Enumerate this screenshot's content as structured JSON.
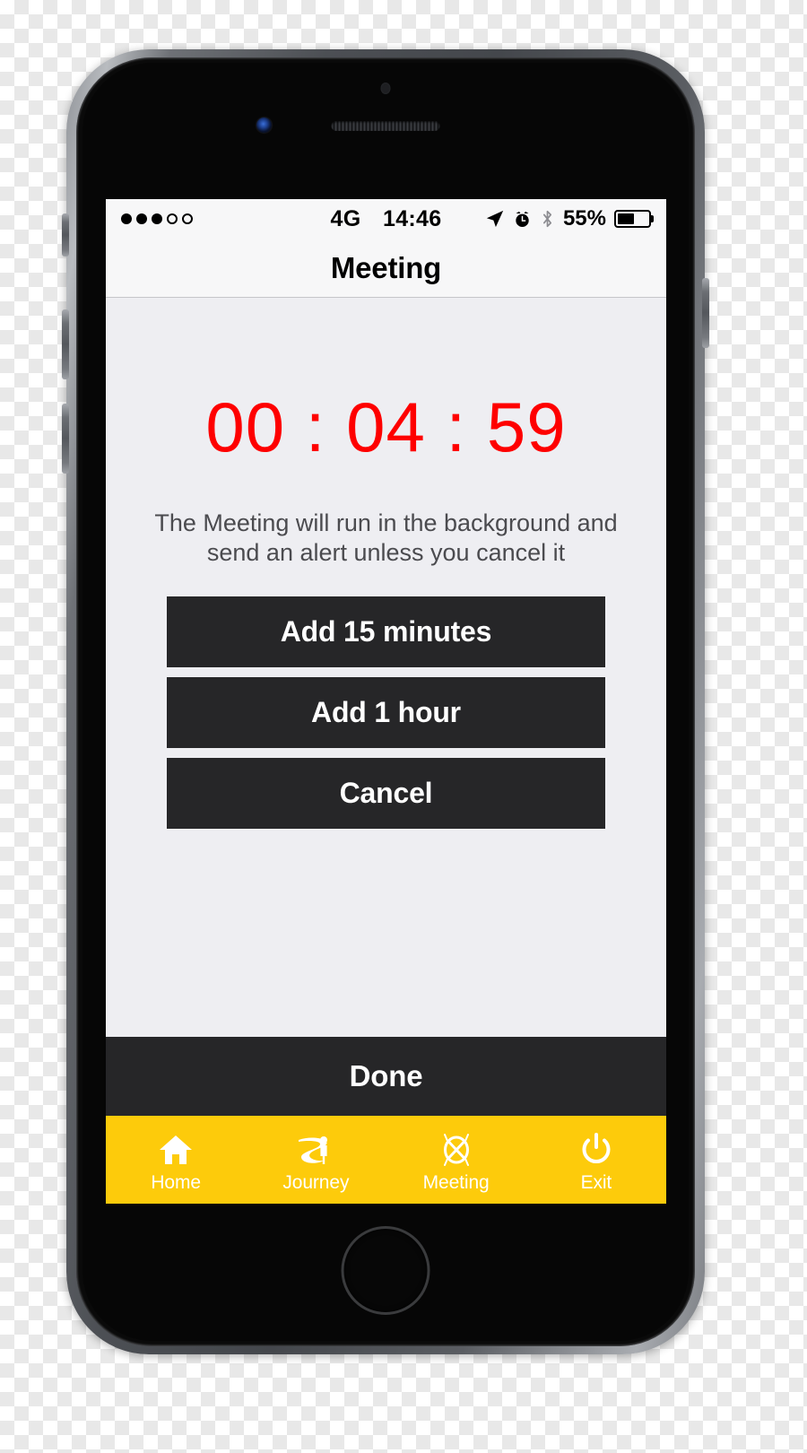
{
  "status_bar": {
    "signal_dots_filled": 3,
    "signal_dots_total": 5,
    "network": "4G",
    "time": "14:46",
    "battery_percent": "55%",
    "battery_level": 55,
    "icons": [
      "location-arrow-icon",
      "alarm-clock-icon",
      "bluetooth-icon"
    ]
  },
  "nav": {
    "title": "Meeting"
  },
  "main": {
    "timer": "00 : 04 : 59",
    "timer_color": "#fe0000",
    "description": "The Meeting will run in the background and send an alert unless you cancel it",
    "buttons": [
      {
        "label": "Add 15 minutes",
        "name": "add-15-minutes-button"
      },
      {
        "label": "Add 1 hour",
        "name": "add-1-hour-button"
      },
      {
        "label": "Cancel",
        "name": "cancel-button"
      }
    ],
    "done_label": "Done"
  },
  "tab_bar": {
    "background_color": "#fdcb0b",
    "text_color": "#ffffff",
    "items": [
      {
        "label": "Home",
        "icon": "home-icon"
      },
      {
        "label": "Journey",
        "icon": "journey-person-road-icon"
      },
      {
        "label": "Meeting",
        "icon": "circle-x-burst-icon"
      },
      {
        "label": "Exit",
        "icon": "power-icon"
      }
    ]
  }
}
